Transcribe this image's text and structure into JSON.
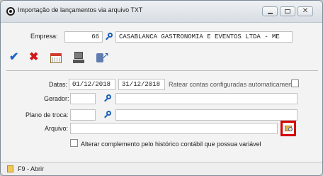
{
  "window": {
    "title": "Importação de lançamentos via arquivo TXT",
    "buttons": {
      "minimize": "",
      "maximize": "",
      "close": "✕"
    }
  },
  "empresa": {
    "label": "Empresa:",
    "code": "66",
    "name": "CASABLANCA GASTRONOMIA E EVENTOS LTDA - ME"
  },
  "toolbar": {
    "confirm_icon": "check-icon",
    "cancel_icon": "x-icon",
    "calendar_icon": "calendar-icon",
    "computer_icon": "computer-icon",
    "database_icon": "database-icon"
  },
  "form": {
    "datas_label": "Datas:",
    "date_start": "01/12/2018",
    "date_end": "31/12/2018",
    "rateio_label": "Ratear contas configuradas automaticamente",
    "gerador_label": "Gerador:",
    "gerador_value": "",
    "gerador_name": "",
    "plano_label": "Plano de troca:",
    "plano_value": "",
    "plano_name": "",
    "arquivo_label": "Arquivo:",
    "arquivo_value": "",
    "alterar_label": "Alterar complemento pelo histórico contábil que possua variável"
  },
  "status": {
    "text": "F9 - Abrir"
  }
}
